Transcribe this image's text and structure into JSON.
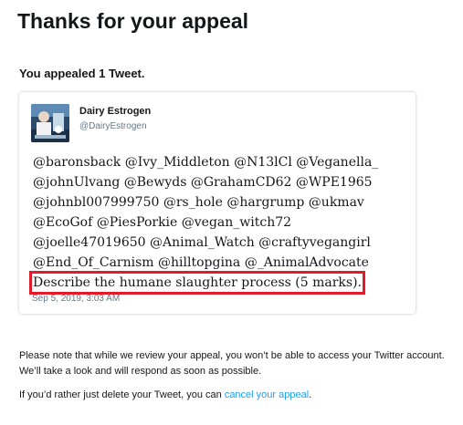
{
  "page": {
    "title": "Thanks for your appeal",
    "appeal_count_text": "You appealed 1 Tweet."
  },
  "tweet": {
    "display_name": "Dairy Estrogen",
    "username": "@DairyEstrogen",
    "avatar_icon": "profile-photo-icon",
    "mention_lines": [
      "@baronsback @Ivy_Middleton @N13lCl @Veganella_",
      "@johnUlvang @Bewyds @GrahamCD62 @WPE1965",
      "@johnbl007999750 @rs_hole @hargrump @ukmav",
      "@EcoGof @PiesPorkie @vegan_witch72",
      "@joelle47019650 @Animal_Watch @craftyvegangirl",
      "@End_Of_Carnism @hilltopgina @_AnimalAdvocate"
    ],
    "highlighted_line": "Describe the humane slaughter process (5 marks).",
    "timestamp": "Sep 5, 2019, 3:03 AM"
  },
  "notice": {
    "text": "Please note that while we review your appeal, you won’t be able to access your Twitter account. We’ll take a look and will respond as soon as possible.",
    "delete_prefix": "If you’d rather just delete your Tweet, you can ",
    "cancel_link": "cancel your appeal",
    "delete_suffix": "."
  },
  "colors": {
    "link": "#1da1f2",
    "highlight_border": "#e21b2b",
    "secondary_text": "#657786",
    "primary_text": "#14171a"
  }
}
